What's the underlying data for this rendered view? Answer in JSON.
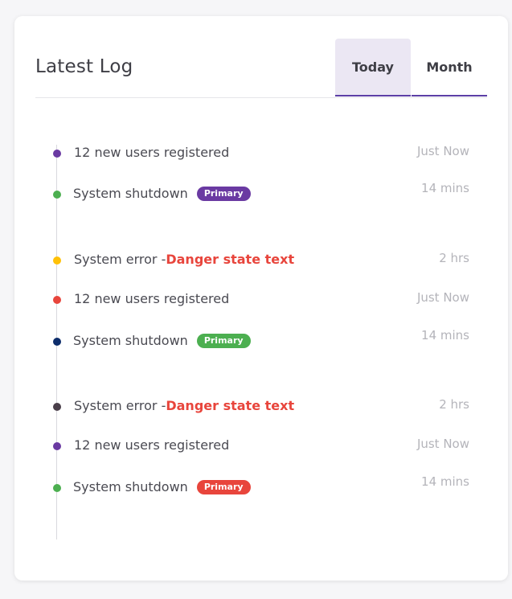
{
  "card": {
    "title": "Latest Log",
    "tabs": [
      {
        "label": "Today",
        "active": true
      },
      {
        "label": "Month",
        "active": false
      }
    ]
  },
  "log": [
    {
      "text": "12 new users registered",
      "danger": "",
      "badge": "",
      "badge_color": "",
      "time": "Just Now",
      "dot_color": "#6a3aa2"
    },
    {
      "text": "System shutdown",
      "danger": "",
      "badge": "Primary",
      "badge_color": "#6a3aa2",
      "time": "14 mins",
      "dot_color": "#4caf50"
    },
    {
      "text": "System error -",
      "danger": "Danger state text",
      "badge": "",
      "badge_color": "",
      "time": "2 hrs",
      "dot_color": "#ffc107"
    },
    {
      "text": "12 new users registered",
      "danger": "",
      "badge": "",
      "badge_color": "",
      "time": "Just Now",
      "dot_color": "#e8453c"
    },
    {
      "text": "System shutdown",
      "danger": "",
      "badge": "Primary",
      "badge_color": "#4caf50",
      "time": "14 mins",
      "dot_color": "#0d2d6b"
    },
    {
      "text": "System error -",
      "danger": "Danger state text",
      "badge": "",
      "badge_color": "",
      "time": "2 hrs",
      "dot_color": "#4a3f4a"
    },
    {
      "text": "12 new users registered",
      "danger": "",
      "badge": "",
      "badge_color": "",
      "time": "Just Now",
      "dot_color": "#6a3aa2"
    },
    {
      "text": "System shutdown",
      "danger": "",
      "badge": "Primary",
      "badge_color": "#e8453c",
      "time": "14 mins",
      "dot_color": "#4caf50"
    }
  ]
}
